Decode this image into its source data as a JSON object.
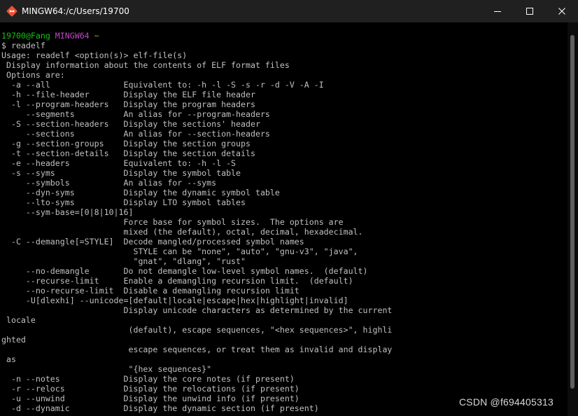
{
  "window": {
    "title": "MINGW64:/c/Users/19700",
    "icon": "git-bash-icon",
    "controls": [
      "minimize-icon",
      "maximize-icon",
      "close-icon"
    ]
  },
  "prompt": {
    "user_host": "19700@Fang",
    "env": "MINGW64",
    "path": "~",
    "command_line": "$ readelf"
  },
  "output_lines": [
    "Usage: readelf <option(s)> elf-file(s)",
    " Display information about the contents of ELF format files",
    " Options are:",
    "  -a --all               Equivalent to: -h -l -S -s -r -d -V -A -I",
    "  -h --file-header       Display the ELF file header",
    "  -l --program-headers   Display the program headers",
    "     --segments          An alias for --program-headers",
    "  -S --section-headers   Display the sections' header",
    "     --sections          An alias for --section-headers",
    "  -g --section-groups    Display the section groups",
    "  -t --section-details   Display the section details",
    "  -e --headers           Equivalent to: -h -l -S",
    "  -s --syms              Display the symbol table",
    "     --symbols           An alias for --syms",
    "     --dyn-syms          Display the dynamic symbol table",
    "     --lto-syms          Display LTO symbol tables",
    "     --sym-base=[0|8|10|16]",
    "                         Force base for symbol sizes.  The options are",
    "                         mixed (the default), octal, decimal, hexadecimal.",
    "  -C --demangle[=STYLE]  Decode mangled/processed symbol names",
    "                           STYLE can be \"none\", \"auto\", \"gnu-v3\", \"java\",",
    "                           \"gnat\", \"dlang\", \"rust\"",
    "     --no-demangle       Do not demangle low-level symbol names.  (default)",
    "     --recurse-limit     Enable a demangling recursion limit.  (default)",
    "     --no-recurse-limit  Disable a demangling recursion limit",
    "     -U[dlexhi] --unicode=[default|locale|escape|hex|highlight|invalid]",
    "                         Display unicode characters as determined by the current",
    " locale",
    "                          (default), escape sequences, \"<hex sequences>\", highli",
    "ghted",
    "                          escape sequences, or treat them as invalid and display",
    " as",
    "                          \"{hex sequences}\"",
    "  -n --notes             Display the core notes (if present)",
    "  -r --relocs            Display the relocations (if present)",
    "  -u --unwind            Display the unwind info (if present)",
    "  -d --dynamic           Display the dynamic section (if present)"
  ],
  "watermark": "CSDN @f694405313",
  "colors": {
    "background": "#000000",
    "text": "#c0c0c0",
    "user_host": "#12c212",
    "env": "#c046c6",
    "path": "#c8a000",
    "titlebar": "#202020"
  }
}
